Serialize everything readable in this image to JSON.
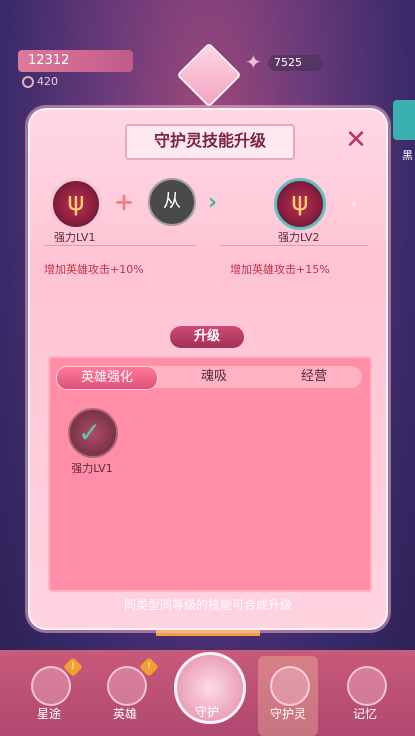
{
  "resources": {
    "gold": "12312",
    "sub_value": "420",
    "right_value": "7525"
  },
  "side_label": "黑",
  "panel": {
    "title": "守护灵技能升级",
    "close_icon": "close-icon",
    "source_skill": {
      "label": "强力LV1",
      "effect": "增加英雄攻击+10%"
    },
    "material_char": "从",
    "target_skill": {
      "label": "强力LV2",
      "effect": "增加英雄攻击+15%"
    },
    "upgrade_label": "升级",
    "tabs": [
      {
        "label": "英雄强化",
        "active": true
      },
      {
        "label": "魂吸",
        "active": false
      },
      {
        "label": "经营",
        "active": false
      }
    ],
    "items": [
      {
        "label": "强力LV1",
        "selected": true
      }
    ],
    "hint": "同类型同等级的技能可合成升级"
  },
  "nav": [
    {
      "label": "星途",
      "alert": "!"
    },
    {
      "label": "英雄",
      "alert": "!"
    },
    {
      "label": "守护",
      "alert": ""
    },
    {
      "label": "守护灵",
      "alert": ""
    },
    {
      "label": "记忆",
      "alert": ""
    }
  ]
}
